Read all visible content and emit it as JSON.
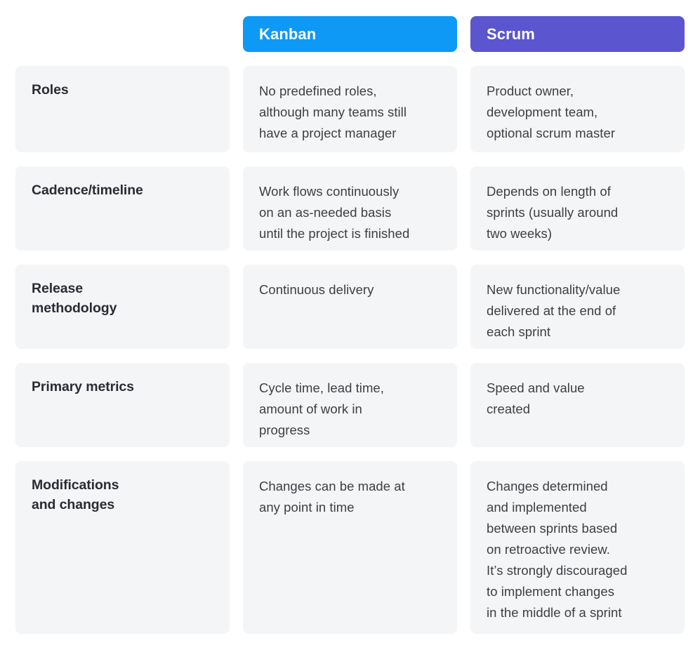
{
  "table": {
    "accent_colors": {
      "kanban": "#0d99f5",
      "scrum": "#5b55cf",
      "cell_background": "#f4f5f7",
      "label_text": "#2b2b33",
      "body_text": "#3c4043",
      "page_background": "#ffffff"
    },
    "header": {
      "label_column": "",
      "columns": [
        {
          "label": "Kanban",
          "color": "#0d99f5"
        },
        {
          "label": "Scrum",
          "color": "#5b55cf"
        }
      ]
    },
    "rows": [
      {
        "label": "Roles",
        "kanban": "No predefined roles,\nalthough many teams still\nhave a project manager",
        "scrum": "Product owner,\ndevelopment team,\noptional scrum master"
      },
      {
        "label": "Cadence/timeline",
        "kanban": "Work flows continuously\non an as-needed basis\nuntil the project is finished",
        "scrum": "Depends on length of\nsprints (usually around\ntwo weeks)"
      },
      {
        "label": "Release\nmethodology",
        "kanban": "Continuous delivery",
        "scrum": "New functionality/value\ndelivered at the end of\neach sprint"
      },
      {
        "label": "Primary metrics",
        "kanban": "Cycle time, lead time,\namount of work in\nprogress",
        "scrum": "Speed and value\ncreated"
      },
      {
        "label": "Modifications\nand changes",
        "kanban": "Changes can be made at\nany point in time",
        "scrum": "Changes determined\nand implemented\nbetween sprints based\non retroactive review.\nIt’s strongly discouraged\nto implement changes\nin the middle of a sprint"
      }
    ]
  }
}
